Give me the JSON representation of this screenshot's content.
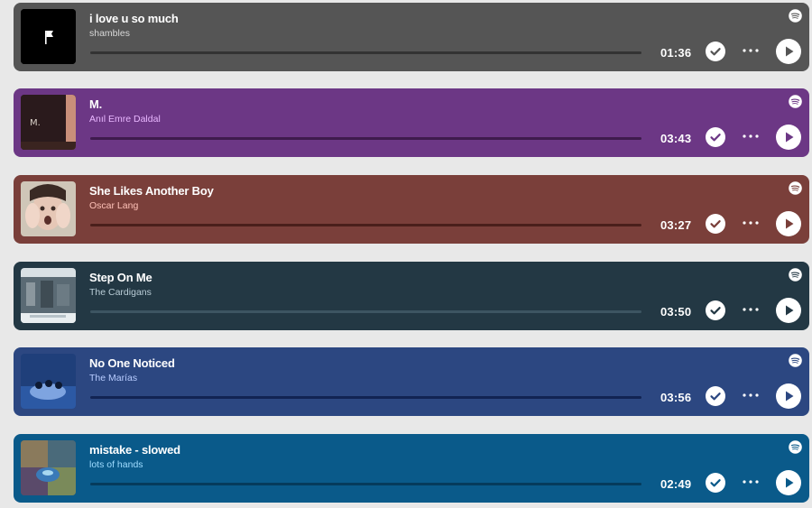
{
  "tracks": [
    {
      "title": "i love u so much",
      "artist": "shambles",
      "time": "01:36",
      "bg": "#555555",
      "artist_color": "#d8d8d8",
      "progress_color": "#333333",
      "art_icon": "flag-icon"
    },
    {
      "title": "M.",
      "artist": "Anıl Emre Daldal",
      "time": "03:43",
      "bg": "#6c3785",
      "artist_color": "#e9b7ff",
      "progress_color": "#3e1b4d",
      "art_icon": "album-art-m"
    },
    {
      "title": "She Likes Another Boy",
      "artist": "Oscar Lang",
      "time": "03:27",
      "bg": "#7a3f3a",
      "artist_color": "#ffc2b8",
      "progress_color": "#4a1f1b",
      "art_icon": "album-art-face"
    },
    {
      "title": "Step On Me",
      "artist": "The Cardigans",
      "time": "03:50",
      "bg": "#233844",
      "artist_color": "#b9ccd6",
      "progress_color": "#3d5562",
      "art_icon": "album-art-concert"
    },
    {
      "title": "No One Noticed",
      "artist": "The Marías",
      "time": "03:56",
      "bg": "#2c4781",
      "artist_color": "#b8ccff",
      "progress_color": "#122453",
      "art_icon": "album-art-band"
    },
    {
      "title": "mistake - slowed",
      "artist": "lots of hands",
      "time": "02:49",
      "bg": "#0a5a8a",
      "artist_color": "#9fdcff",
      "progress_color": "#053b5c",
      "art_icon": "album-art-collage"
    }
  ]
}
